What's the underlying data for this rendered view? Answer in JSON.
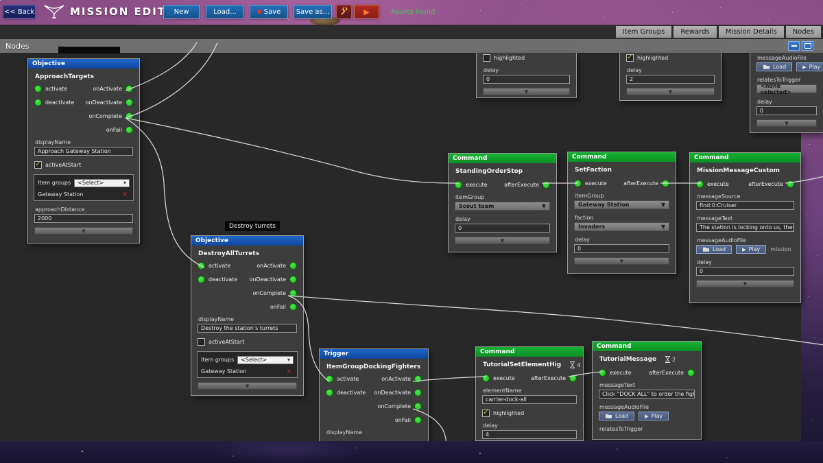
{
  "top_bar": {
    "back": "<< Back",
    "title": "MISSION EDITOR",
    "new": "New",
    "load": "Load...",
    "save": "Save",
    "save_as": "Save as...",
    "assets_status": "Assets found"
  },
  "tab_bar": {
    "tabs": [
      "Item Groups",
      "Rewards",
      "Mission Details",
      "Nodes"
    ]
  },
  "panel": {
    "title": "Nodes"
  },
  "tooltip": {
    "text": "Destroy turrets"
  },
  "icons": {
    "check": "✓",
    "close": "✕",
    "chevron": "▾",
    "collapse": "▼",
    "play": "▶"
  },
  "colors": {
    "accent_blue": "#1e66c8",
    "accent_green": "#17b032",
    "port_green": "#2dd62d",
    "assets_green": "#4ec162"
  },
  "labels": {
    "activate": "activate",
    "deactivate": "deactivate",
    "on_activate": "onActivate",
    "on_deactivate": "onDeactivate",
    "on_complete": "onComplete",
    "on_fail": "onFail",
    "execute": "execute",
    "after_execute": "afterExecute",
    "display_name": "displayName",
    "active_at_start": "activeAtStart",
    "item_groups": "Item groups",
    "select": "<Select>",
    "delay": "delay",
    "item_group": "itemGroup",
    "faction": "faction",
    "highlighted": "highlighted",
    "element_name": "elementName",
    "message_source": "messageSource",
    "message_text": "messageText",
    "message_audio_file": "messageAudioFile",
    "relates_to_trigger": "relatesToTrigger",
    "load": "Load",
    "play": "Play"
  },
  "nodes": {
    "approach": {
      "header": "Objective",
      "title": "ApproachTargets",
      "display_name_value": "Approach Gateway Station",
      "item": "Gateway Station",
      "approach_distance_label": "approachDistance",
      "approach_distance_value": "2000"
    },
    "destroy": {
      "header": "Objective",
      "title": "DestroyAllTurrets",
      "display_name_value": "Destroy the station's turrets",
      "item": "Gateway Station"
    },
    "trigger": {
      "header": "Trigger",
      "title": "ItemGroupDockingFighters"
    },
    "standing_order": {
      "header": "Command",
      "title": "StandingOrderStop",
      "item_group_value": "Scout team",
      "delay_value": "0"
    },
    "set_faction": {
      "header": "Command",
      "title": "SetFaction",
      "item_group_value": "Gateway Station",
      "faction_value": "Invaders",
      "delay_value": "0"
    },
    "mission_message": {
      "header": "Command",
      "title": "MissionMessageCustom",
      "message_source_value": "find:0:Cruiser",
      "message_text_value": "The station is locking onto us, they've g",
      "note": "mission",
      "delay_value": "0"
    },
    "tutorial_set": {
      "header": "Command",
      "title": "TutorialSetElementHig",
      "badge_count": "4",
      "element_name_value": "carrier-dock-all",
      "delay_value": "4"
    },
    "tutorial_message": {
      "header": "Command",
      "title": "TutorialMessage",
      "badge_count": "2",
      "message_text_value": "Click \"DOCK ALL\" to order the fighters t"
    },
    "partial_top_left": {
      "delay_value": "0"
    },
    "partial_top_mid": {
      "delay_value": "2"
    },
    "partial_top_right": {
      "relates_value": "<none selected>",
      "delay_value": "0"
    }
  }
}
